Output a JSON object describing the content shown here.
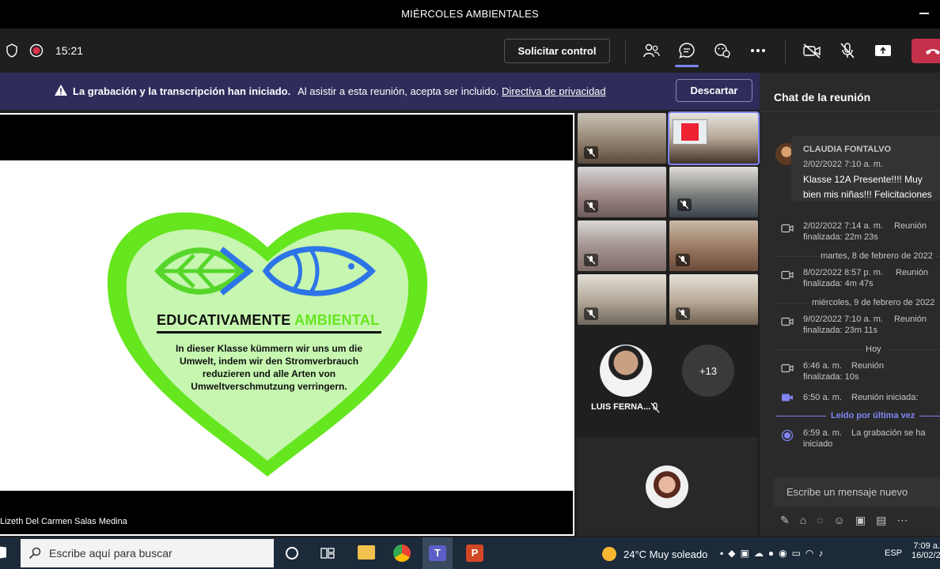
{
  "window": {
    "title": "MIÉRCOLES AMBIENTALES"
  },
  "toolbar": {
    "timer": "15:21",
    "request_control_label": "Solicitar control",
    "icons": [
      "shield-icon",
      "record-icon",
      "people-icon",
      "chat-icon",
      "reactions-icon",
      "more-icon",
      "camera-off-icon",
      "mic-off-icon",
      "share-icon",
      "hangup-icon"
    ]
  },
  "banner": {
    "bold_text": "La grabación y la transcripción han iniciado.",
    "text": "Al asistir a esta reunión, acepta ser incluido.",
    "link": "Directiva de privacidad",
    "dismiss_label": "Descartar"
  },
  "slide": {
    "brand_a": "EDUCATIVAMENTE",
    "brand_b": "AMBIENTAL",
    "body": [
      "In dieser Klasse kümmern wir uns um die",
      "Umwelt, indem wir den Stromverbrauch",
      "reduzieren und alle Arten von",
      "Umweltverschmutzung verringern."
    ],
    "presenter": "Lizeth Del Carmen Salas Medina"
  },
  "participants": {
    "spotlight_name": "LUIS FERNA...",
    "overflow": "+13"
  },
  "chat": {
    "title": "Chat de la reunión",
    "msg1_author": "CLAUDIA FONTALVO",
    "msg1_time": "2/02/2022 7:10 a. m.",
    "msg1_text_1": "Klasse 12A Presente!!!! Muy",
    "msg1_text_2": "bien mis niñas!!! Felicitaciones",
    "ev1_time": "2/02/2022 7:14 a. m.",
    "ev1_a": "Reunión",
    "ev1_b": "finalizada: 22m 23s",
    "date1": "martes, 8 de febrero de 2022",
    "ev2_time": "8/02/2022 8:57 p. m.",
    "ev2_a": "Reunión",
    "ev2_b": "finalizada: 4m 47s",
    "date2": "miércoles, 9 de febrero de 2022",
    "ev3_time": "9/02/2022 7:10 a. m.",
    "ev3_a": "Reunión",
    "ev3_b": "finalizada: 23m 11s",
    "date3": "Hoy",
    "ev4_time": "6:46 a. m.",
    "ev4_a": "Reunión",
    "ev4_b": "finalizada: 10s",
    "ev5_time": "6:50 a. m.",
    "ev5_a": "Reunión iniciada:",
    "last_read": "Leído por última vez",
    "ev6_time": "6:59 a. m.",
    "ev6_a": "La grabación se ha",
    "ev6_b": "iniciado",
    "input_placeholder": "Escribe un mensaje nuevo"
  },
  "taskbar": {
    "search_placeholder": "Escribe aquí para buscar",
    "weather": "24°C  Muy soleado",
    "lang": "ESP",
    "time": "7:09 a.",
    "date": "16/02/2"
  },
  "colors": {
    "accent": "#7f85f5",
    "banner": "#2d2c5a",
    "hangup": "#c4314b",
    "green": "#66e61e"
  }
}
